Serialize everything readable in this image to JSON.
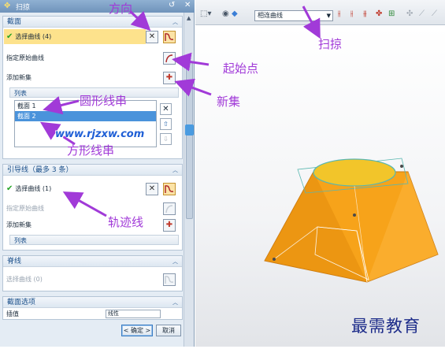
{
  "dialog": {
    "title": "扫掠",
    "section_curve": {
      "title": "截面",
      "select_curve": "选择曲线 (4)",
      "specify_origin": "指定原始曲线",
      "add_new_set": "添加新集",
      "list_title": "列表",
      "list_items": [
        "截面 1",
        "截面 2"
      ]
    },
    "section_guide": {
      "title": "引导线（最多 3 条）",
      "select_curve": "选择曲线 (1)",
      "specify_origin": "指定原始曲线",
      "add_new_set": "添加新集",
      "list_title": "列表"
    },
    "section_spine": {
      "title": "脊线",
      "select_curve": "选择曲线 (0)"
    },
    "section_options": {
      "title": "截面选项",
      "row_label": "插值",
      "row_value": "线性"
    },
    "ok_label": "< 确定 >",
    "cancel_label": "取消"
  },
  "toolbar": {
    "combo_value": "相连曲线"
  },
  "annotations": {
    "direction": "方向",
    "sweep": "扫掠",
    "start_point": "起始点",
    "new_set": "新集",
    "circle_string": "圆形线串",
    "square_string": "方形线串",
    "trajectory": "轨迹线"
  },
  "watermark": "www.rjzxw.com",
  "brand": "最需教育",
  "colors": {
    "solid_fill": "#f7a31a",
    "annotation": "#a13ad8",
    "selection": "#4a93db",
    "highlight": "#fde28c"
  }
}
